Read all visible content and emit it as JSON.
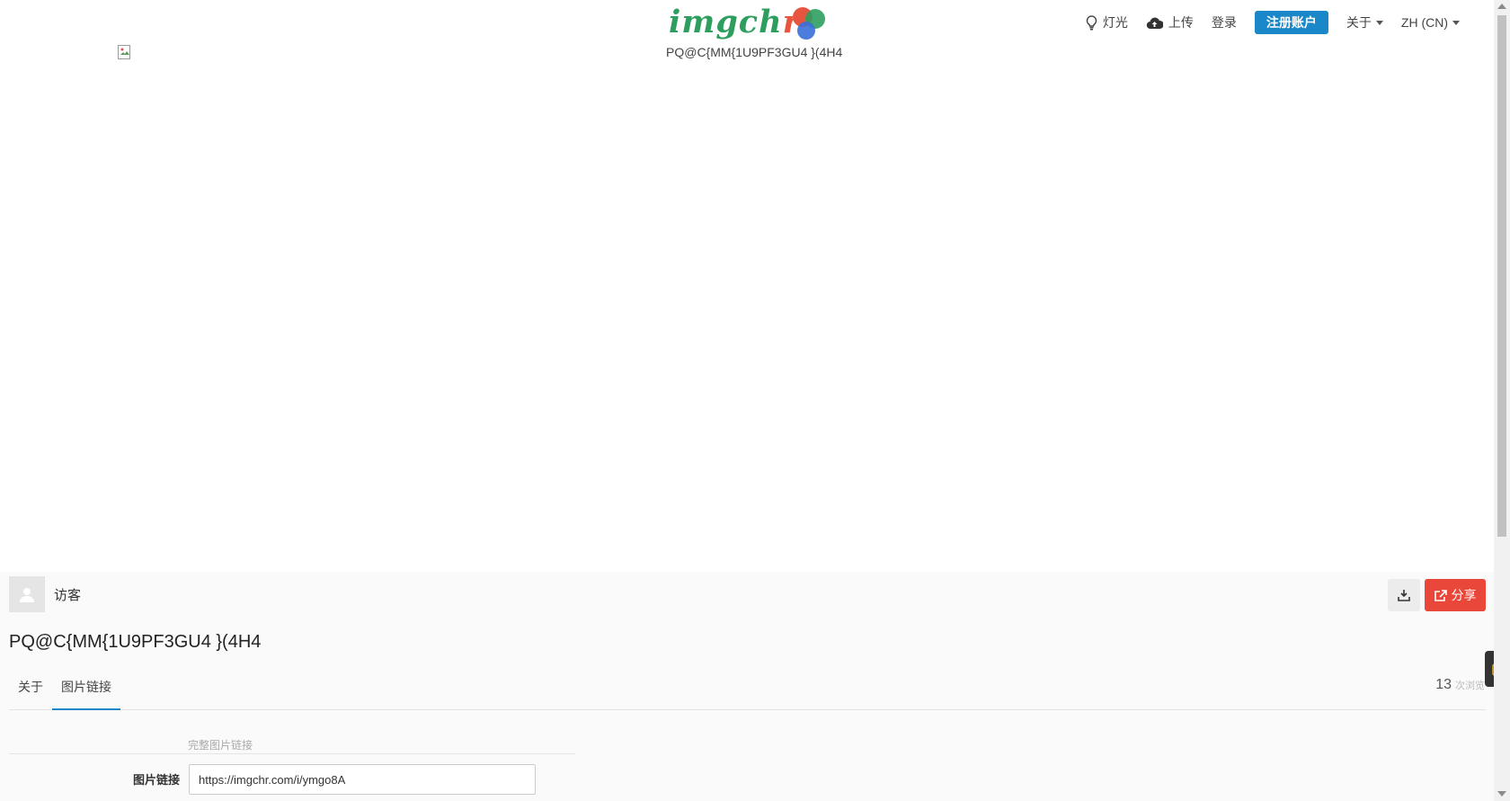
{
  "brand": {
    "logo_text_main": "imgch",
    "logo_text_accent": "r",
    "colors": {
      "green": "#2e9e5f",
      "red": "#e8553f",
      "blue": "#3a6fd8"
    }
  },
  "nav": {
    "light_label": "灯光",
    "upload_label": "上传",
    "login_label": "登录",
    "register_label": "注册账户",
    "about_label": "关于",
    "lang_label": "ZH (CN)"
  },
  "image": {
    "caption": "PQ@C{MM{1U9PF3GU4 }(4H4"
  },
  "owner": {
    "name": "访客"
  },
  "actions": {
    "share_label": "分享"
  },
  "title": "PQ@C{MM{1U9PF3GU4 }(4H4",
  "tabs": [
    {
      "label": "关于"
    },
    {
      "label": "图片链接"
    }
  ],
  "stats": {
    "views_count": "13",
    "views_label": "次浏览"
  },
  "links": {
    "section_label": "完整图片链接",
    "field_label": "图片链接",
    "field_value": "https://imgchr.com/i/ymgo8A"
  },
  "accent_color": "#1a87c9",
  "danger_color": "#e8473a"
}
